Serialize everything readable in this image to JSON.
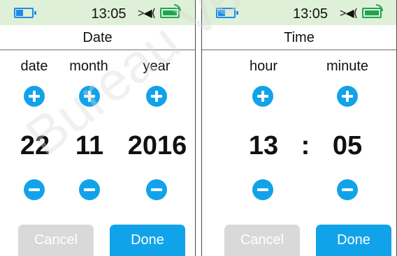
{
  "colors": {
    "accent": "#11a3ea",
    "statusbar_bg": "#dff0d8",
    "battery": "#1e8ce6",
    "signal": "#1fa650",
    "cancel_bg": "#d9d9d9"
  },
  "date_screen": {
    "status": {
      "time": "13:05",
      "battery_level": 0.4
    },
    "title": "Date",
    "columns": [
      {
        "label": "date",
        "value": "22"
      },
      {
        "label": "month",
        "value": "11"
      },
      {
        "label": "year",
        "value": "2016"
      }
    ],
    "cancel_label": "Cancel",
    "done_label": "Done"
  },
  "time_screen": {
    "status": {
      "time": "13:05",
      "battery_level": 0.4
    },
    "title": "Time",
    "columns": [
      {
        "label": "hour",
        "value": "13"
      },
      {
        "label": "minute",
        "value": "05"
      }
    ],
    "separator": ":",
    "cancel_label": "Cancel",
    "done_label": "Done"
  },
  "watermark_text": "Bureau Veritas"
}
